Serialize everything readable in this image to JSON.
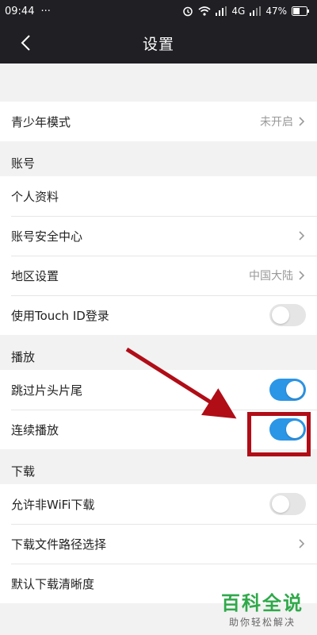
{
  "status_bar": {
    "time": "09:44",
    "more": "···",
    "network": "4G",
    "battery": "47%"
  },
  "nav": {
    "title": "设置",
    "back_icon": "chevron-left-icon"
  },
  "rows": {
    "youth_mode": {
      "label": "青少年模式",
      "value": "未开启"
    },
    "account_header": "账号",
    "profile": {
      "label": "个人资料"
    },
    "security": {
      "label": "账号安全中心"
    },
    "region": {
      "label": "地区设置",
      "value": "中国大陆"
    },
    "touch_id": {
      "label": "使用Touch ID登录",
      "on": false
    },
    "play_header": "播放",
    "skip_intro": {
      "label": "跳过片头片尾",
      "on": true
    },
    "autoplay": {
      "label": "连续播放",
      "on": true
    },
    "download_header": "下载",
    "non_wifi": {
      "label": "允许非WiFi下载",
      "on": false
    },
    "download_path": {
      "label": "下载文件路径选择"
    },
    "download_quality": {
      "label": "默认下载清晰度"
    }
  },
  "watermark": {
    "main": "百科全说",
    "sub": "助你轻松解决"
  },
  "colors": {
    "toggle_on": "#2b95e6",
    "annotation": "#b00d17",
    "watermark": "#2fa94a"
  }
}
